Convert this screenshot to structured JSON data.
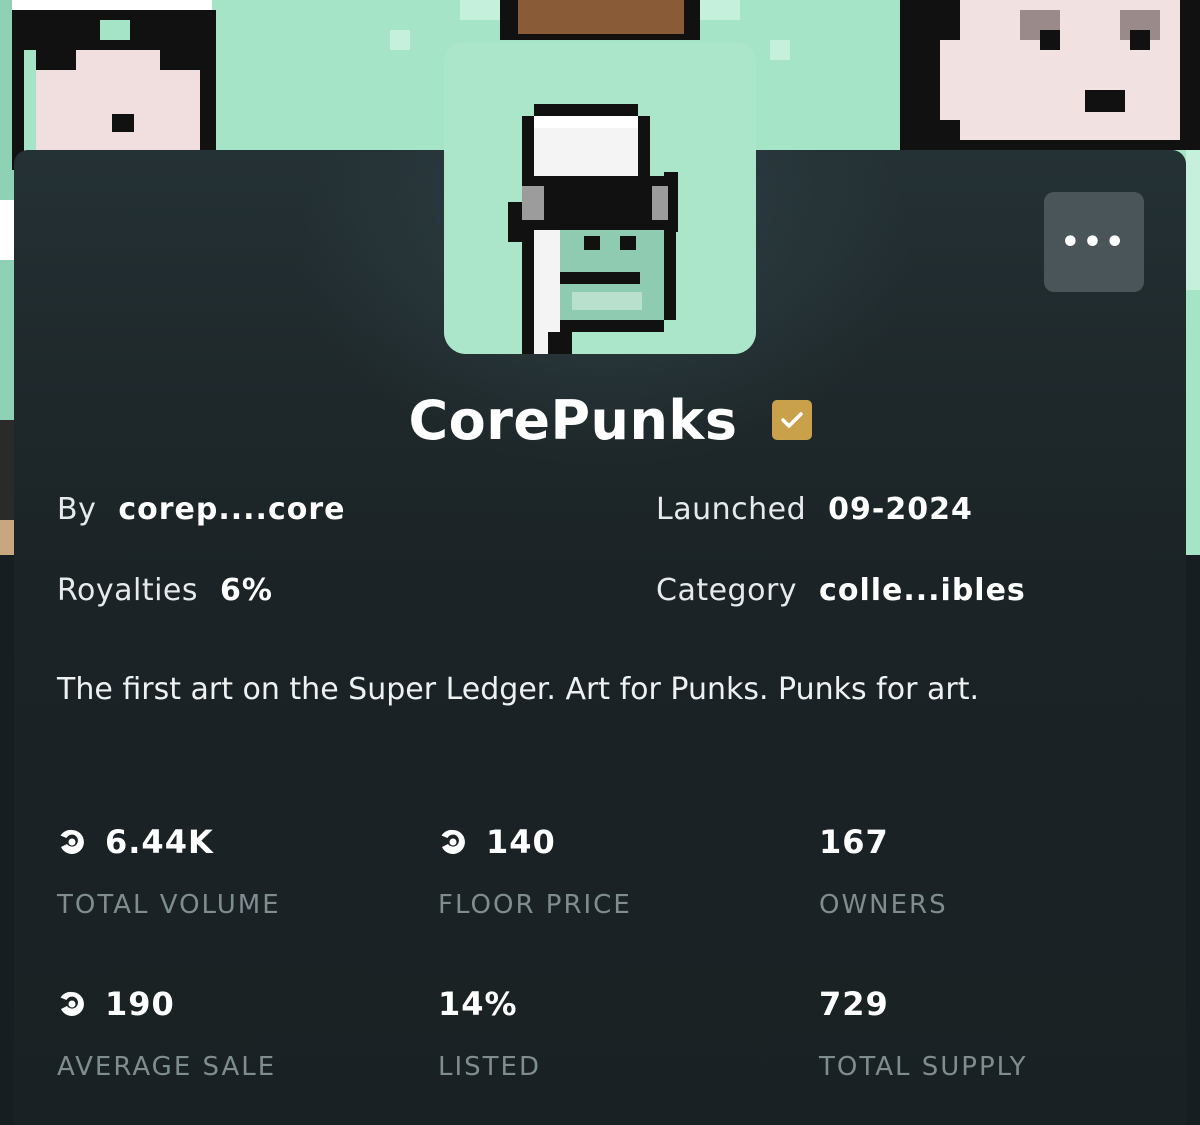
{
  "collection": {
    "name": "CorePunks",
    "verified": true,
    "by_label": "By",
    "by_value": "corep....core",
    "launched_label": "Launched",
    "launched_value": "09-2024",
    "royalties_label": "Royalties",
    "royalties_value": "6%",
    "category_label": "Category",
    "category_value": "colle...ibles",
    "description": "The first art on the Super Ledger. Art for Punks. Punks for art."
  },
  "menu": {
    "more_label": "•••"
  },
  "stats": [
    {
      "value": "6.44K",
      "label": "TOTAL VOLUME",
      "icon": "core-coin-icon"
    },
    {
      "value": "140",
      "label": "FLOOR PRICE",
      "icon": "core-coin-icon"
    },
    {
      "value": "167",
      "label": "OWNERS",
      "icon": ""
    },
    {
      "value": "190",
      "label": "AVERAGE SALE",
      "icon": "core-coin-icon"
    },
    {
      "value": "14%",
      "label": "LISTED",
      "icon": ""
    },
    {
      "value": "729",
      "label": "TOTAL SUPPLY",
      "icon": ""
    }
  ],
  "colors": {
    "banner_bg": "#a6e4c8",
    "card_bg": "#1f292c",
    "verified_badge": "#c9a14a",
    "label_muted": "#7f8c90"
  }
}
